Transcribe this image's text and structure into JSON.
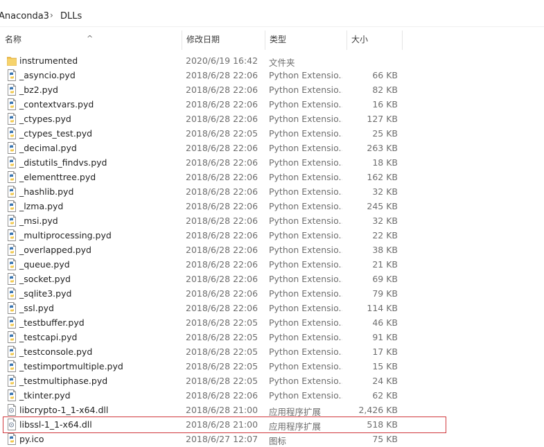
{
  "breadcrumb": {
    "parent": "Anaconda3",
    "current": "DLLs",
    "separator": "›"
  },
  "columns": {
    "name": "名称",
    "date": "修改日期",
    "type": "类型",
    "size": "大小"
  },
  "files": [
    {
      "name": "instrumented",
      "date": "2020/6/19 16:42",
      "type": "文件夹",
      "size": "",
      "icon": "folder"
    },
    {
      "name": "_asyncio.pyd",
      "date": "2018/6/28 22:06",
      "type": "Python Extensio...",
      "size": "66 KB",
      "icon": "python-file"
    },
    {
      "name": "_bz2.pyd",
      "date": "2018/6/28 22:06",
      "type": "Python Extensio...",
      "size": "82 KB",
      "icon": "python-file"
    },
    {
      "name": "_contextvars.pyd",
      "date": "2018/6/28 22:06",
      "type": "Python Extensio...",
      "size": "16 KB",
      "icon": "python-file"
    },
    {
      "name": "_ctypes.pyd",
      "date": "2018/6/28 22:06",
      "type": "Python Extensio...",
      "size": "127 KB",
      "icon": "python-file"
    },
    {
      "name": "_ctypes_test.pyd",
      "date": "2018/6/28 22:05",
      "type": "Python Extensio...",
      "size": "25 KB",
      "icon": "python-file"
    },
    {
      "name": "_decimal.pyd",
      "date": "2018/6/28 22:06",
      "type": "Python Extensio...",
      "size": "263 KB",
      "icon": "python-file"
    },
    {
      "name": "_distutils_findvs.pyd",
      "date": "2018/6/28 22:06",
      "type": "Python Extensio...",
      "size": "18 KB",
      "icon": "python-file"
    },
    {
      "name": "_elementtree.pyd",
      "date": "2018/6/28 22:06",
      "type": "Python Extensio...",
      "size": "162 KB",
      "icon": "python-file"
    },
    {
      "name": "_hashlib.pyd",
      "date": "2018/6/28 22:06",
      "type": "Python Extensio...",
      "size": "32 KB",
      "icon": "python-file"
    },
    {
      "name": "_lzma.pyd",
      "date": "2018/6/28 22:06",
      "type": "Python Extensio...",
      "size": "245 KB",
      "icon": "python-file"
    },
    {
      "name": "_msi.pyd",
      "date": "2018/6/28 22:06",
      "type": "Python Extensio...",
      "size": "32 KB",
      "icon": "python-file"
    },
    {
      "name": "_multiprocessing.pyd",
      "date": "2018/6/28 22:06",
      "type": "Python Extensio...",
      "size": "22 KB",
      "icon": "python-file"
    },
    {
      "name": "_overlapped.pyd",
      "date": "2018/6/28 22:06",
      "type": "Python Extensio...",
      "size": "38 KB",
      "icon": "python-file"
    },
    {
      "name": "_queue.pyd",
      "date": "2018/6/28 22:06",
      "type": "Python Extensio...",
      "size": "21 KB",
      "icon": "python-file"
    },
    {
      "name": "_socket.pyd",
      "date": "2018/6/28 22:06",
      "type": "Python Extensio...",
      "size": "69 KB",
      "icon": "python-file"
    },
    {
      "name": "_sqlite3.pyd",
      "date": "2018/6/28 22:06",
      "type": "Python Extensio...",
      "size": "79 KB",
      "icon": "python-file"
    },
    {
      "name": "_ssl.pyd",
      "date": "2018/6/28 22:06",
      "type": "Python Extensio...",
      "size": "114 KB",
      "icon": "python-file"
    },
    {
      "name": "_testbuffer.pyd",
      "date": "2018/6/28 22:05",
      "type": "Python Extensio...",
      "size": "46 KB",
      "icon": "python-file"
    },
    {
      "name": "_testcapi.pyd",
      "date": "2018/6/28 22:05",
      "type": "Python Extensio...",
      "size": "91 KB",
      "icon": "python-file"
    },
    {
      "name": "_testconsole.pyd",
      "date": "2018/6/28 22:05",
      "type": "Python Extensio...",
      "size": "17 KB",
      "icon": "python-file"
    },
    {
      "name": "_testimportmultiple.pyd",
      "date": "2018/6/28 22:05",
      "type": "Python Extensio...",
      "size": "15 KB",
      "icon": "python-file"
    },
    {
      "name": "_testmultiphase.pyd",
      "date": "2018/6/28 22:05",
      "type": "Python Extensio...",
      "size": "24 KB",
      "icon": "python-file"
    },
    {
      "name": "_tkinter.pyd",
      "date": "2018/6/28 22:06",
      "type": "Python Extensio...",
      "size": "62 KB",
      "icon": "python-file"
    },
    {
      "name": "libcrypto-1_1-x64.dll",
      "date": "2018/6/28 21:00",
      "type": "应用程序扩展",
      "size": "2,426 KB",
      "icon": "dll-file"
    },
    {
      "name": "libssl-1_1-x64.dll",
      "date": "2018/6/28 21:00",
      "type": "应用程序扩展",
      "size": "518 KB",
      "icon": "dll-file",
      "highlighted": true
    },
    {
      "name": "py.ico",
      "date": "2018/6/27 12:07",
      "type": "图标",
      "size": "75 KB",
      "icon": "python-file"
    }
  ],
  "colors": {
    "highlight_border": "#d0383c",
    "folder": "#f3c24e",
    "python_blue": "#3a75b0",
    "python_yellow": "#f2c94c"
  }
}
